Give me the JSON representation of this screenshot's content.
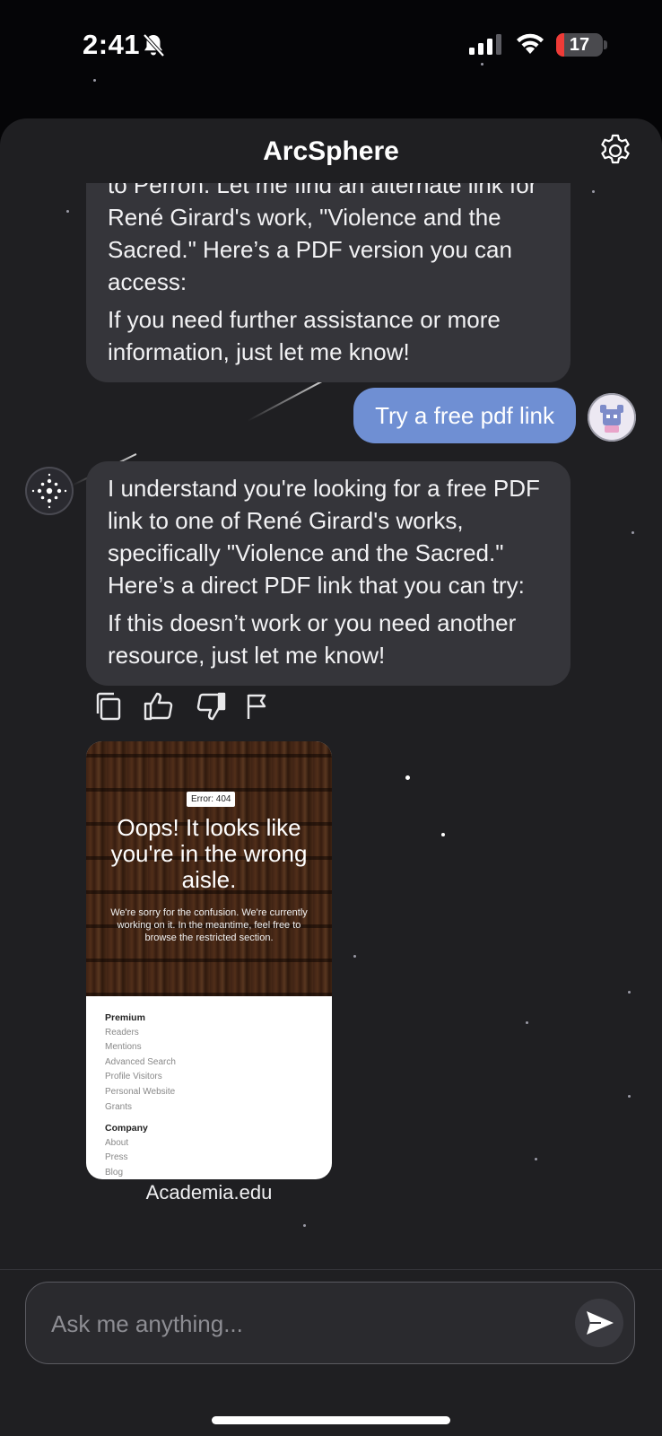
{
  "status_bar": {
    "time": "2:41",
    "battery_level": "17",
    "battery_fraction": 0.17,
    "icons": [
      "bell-slash-icon",
      "cellular-signal-icon",
      "wifi-icon",
      "battery-icon"
    ]
  },
  "header": {
    "title": "ArcSphere",
    "settings_icon": "gear-icon"
  },
  "messages": [
    {
      "role": "assistant",
      "paragraphs": [
        "to Perron. Let me find an alternate link for René Girard's work, \"Violence and the Sacred.\" Here’s a PDF version you can access:",
        "If you need further assistance or more information, just let me know!"
      ]
    },
    {
      "role": "user",
      "text": "Try a free pdf link"
    },
    {
      "role": "assistant",
      "paragraphs": [
        "I understand you're looking for a free PDF link to one of René Girard's works, specifically \"Violence and the Sacred.\" Here’s a direct PDF link that you can try:",
        "If this doesn’t work or you need another resource, just let me know!"
      ]
    }
  ],
  "message_actions": [
    "copy-icon",
    "thumbs-up-icon",
    "thumbs-down-icon",
    "flag-icon"
  ],
  "link_preview": {
    "error_badge": "Error: 404",
    "headline": "Oops! It looks like you're in the wrong aisle.",
    "subtext": "We're sorry for the confusion. We're currently working on it. In the meantime, feel free to browse the restricted section.",
    "menu_sections": [
      {
        "heading": "Premium",
        "items": [
          "Readers",
          "Mentions",
          "Advanced Search",
          "Profile Visitors",
          "Personal Website",
          "Grants"
        ]
      },
      {
        "heading": "Company",
        "items": [
          "About",
          "Press",
          "Blog"
        ]
      }
    ],
    "caption": "Academia.edu"
  },
  "composer": {
    "placeholder": "Ask me anything...",
    "send_icon": "send-icon"
  },
  "colors": {
    "background": "#050507",
    "panel": "#1f1f22",
    "assistant_bubble": "#35353a",
    "user_bubble": "#6f8fd3",
    "battery_low": "#ef3b37"
  }
}
